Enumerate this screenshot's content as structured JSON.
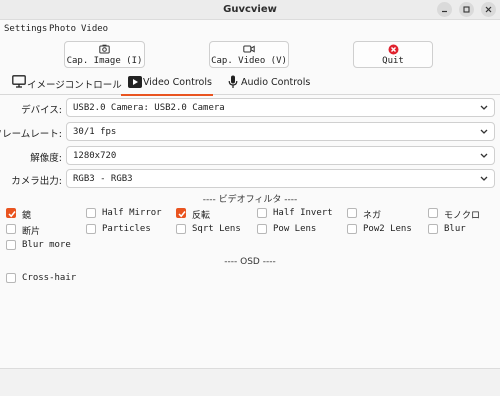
{
  "window": {
    "title": "Guvcview"
  },
  "menubar": {
    "items": [
      "Settings",
      "Photo",
      "Video"
    ]
  },
  "toolbar": {
    "cap_image": "Cap. Image (I)",
    "cap_video": "Cap. Video (V)",
    "quit": "Quit",
    "quit_icon_color": "#e0222e"
  },
  "tabs": [
    {
      "label": "イメージコントロール",
      "active": false
    },
    {
      "label": "Video Controls",
      "active": true
    },
    {
      "label": "Audio Controls",
      "active": false
    }
  ],
  "accent_color": "#e95420",
  "video_controls": {
    "device": {
      "label": "デバイス:",
      "value": "USB2.0 Camera: USB2.0 Camera"
    },
    "frame_rate": {
      "label": "フレームレート:",
      "value": "30/1 fps"
    },
    "resolution": {
      "label": "解像度:",
      "value": "1280x720"
    },
    "camera_output": {
      "label": "カメラ出力:",
      "value": "RGB3 - RGB3"
    }
  },
  "video_filters": {
    "title": "---- ビデオフィルタ ----",
    "items": [
      {
        "label": "鏡",
        "checked": true
      },
      {
        "label": "Half Mirror",
        "checked": false
      },
      {
        "label": "反転",
        "checked": true
      },
      {
        "label": "Half Invert",
        "checked": false
      },
      {
        "label": "ネガ",
        "checked": false
      },
      {
        "label": "モノクロ",
        "checked": false
      },
      {
        "label": "断片",
        "checked": false
      },
      {
        "label": "Particles",
        "checked": false
      },
      {
        "label": "Sqrt Lens",
        "checked": false
      },
      {
        "label": "Pow Lens",
        "checked": false
      },
      {
        "label": "Pow2 Lens",
        "checked": false
      },
      {
        "label": "Blur",
        "checked": false
      },
      {
        "label": "Blur more",
        "checked": false
      }
    ]
  },
  "osd": {
    "title": "---- OSD ----",
    "items": [
      {
        "label": "Cross-hair",
        "checked": false
      }
    ]
  }
}
